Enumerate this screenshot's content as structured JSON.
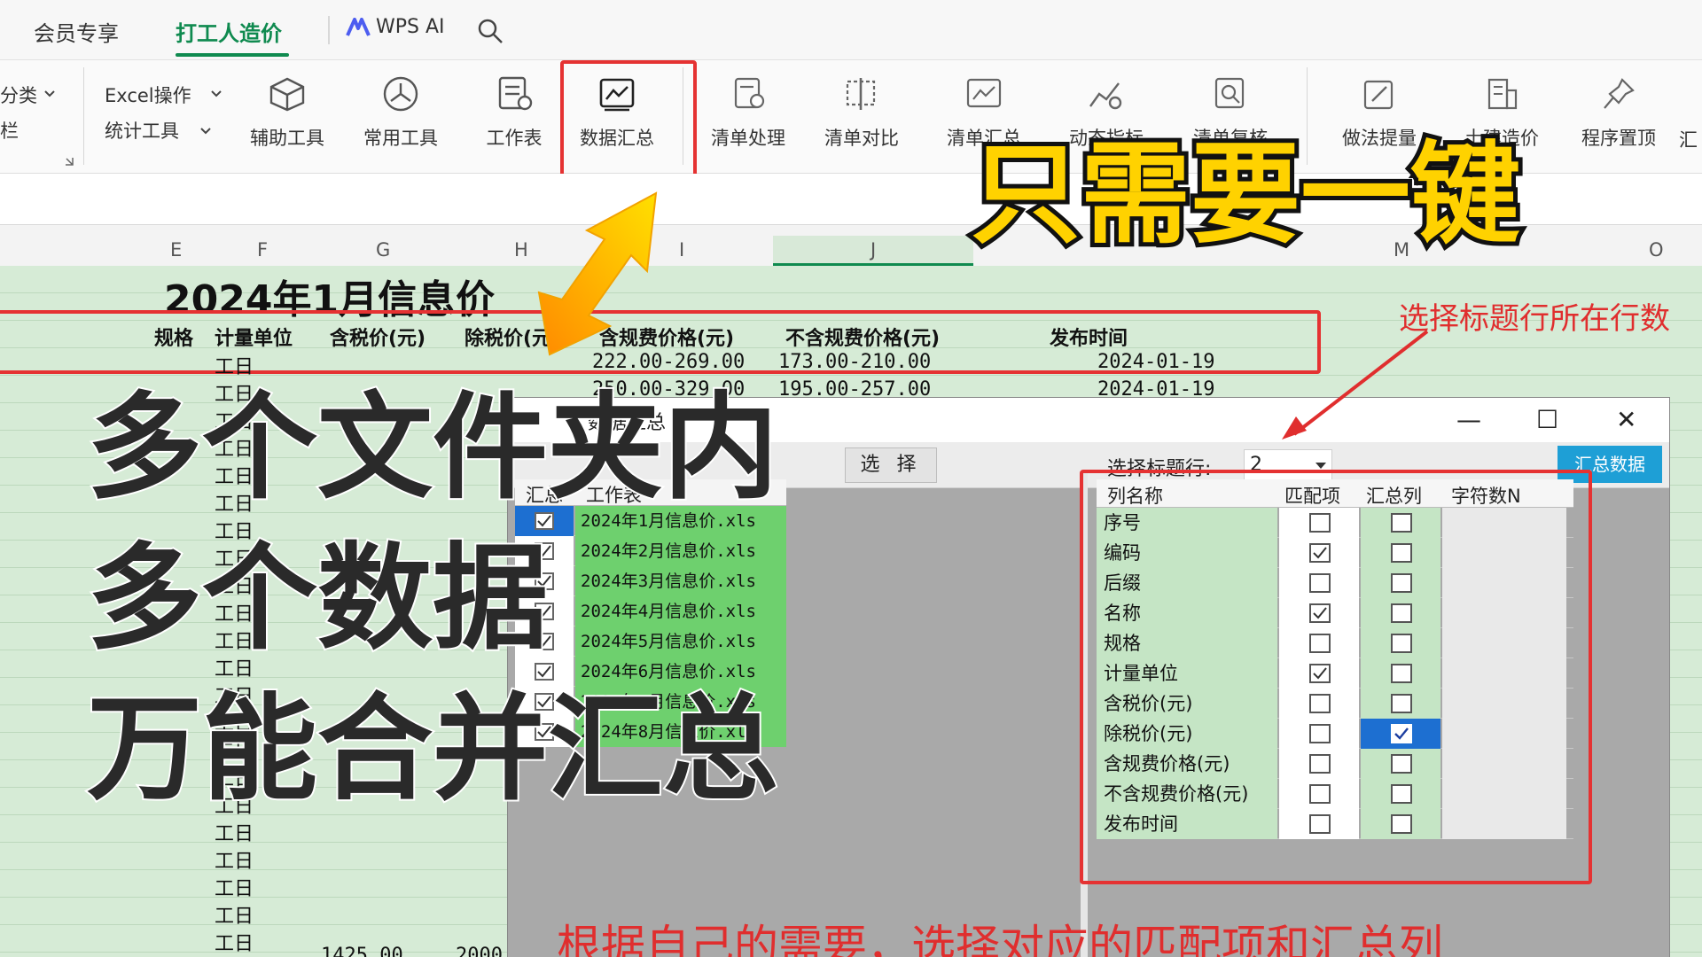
{
  "top_tabs": {
    "member": "会员专享",
    "active": "打工人造价",
    "wps_ai": "WPS AI"
  },
  "ribbon": {
    "left_labels": [
      "分类",
      "栏"
    ],
    "excel_ops": "Excel操作",
    "stats_tools": "统计工具",
    "items": [
      "辅助工具",
      "常用工具",
      "工作表",
      "数据汇总",
      "清单处理",
      "清单对比",
      "清单汇总",
      "动态指标",
      "清单复核",
      "做法提量",
      "土建造价",
      "程序置顶",
      "汇"
    ],
    "highlighted": "数据汇总"
  },
  "column_headers": [
    "E",
    "F",
    "G",
    "H",
    "I",
    "J",
    "M",
    "O"
  ],
  "sheet": {
    "title": "2024年1月信息价",
    "headers": [
      "规格",
      "计量单位",
      "含税价(元)",
      "除税价(元)",
      "含规费价格(元)",
      "不含规费价格(元)",
      "发布时间"
    ],
    "rows": [
      {
        "unit": "工日",
        "incl": "222.00-269.00",
        "excl": "173.00-210.00",
        "date": "2024-01-19"
      },
      {
        "unit": "工日",
        "incl": "250.00-329.00",
        "excl": "195.00-257.00",
        "date": "2024-01-19"
      }
    ],
    "unit_repeat": "工日",
    "bottom_values": [
      "1425.00",
      "2000"
    ]
  },
  "dialog": {
    "title": "数据汇总",
    "select_button": "选 择",
    "header_row_label": "选择标题行:",
    "header_row_value": "2",
    "summarize_button": "汇总数据",
    "file_table": {
      "headers": [
        "汇总",
        "工作表"
      ],
      "files": [
        {
          "name": "2024年1月信息价.xls",
          "checked": true,
          "selected": true
        },
        {
          "name": "2024年2月信息价.xls",
          "checked": true,
          "selected": false
        },
        {
          "name": "2024年3月信息价.xls",
          "checked": true,
          "selected": false
        },
        {
          "name": "2024年4月信息价.xls",
          "checked": true,
          "selected": false
        },
        {
          "name": "2024年5月信息价.xls",
          "checked": true,
          "selected": false
        },
        {
          "name": "2024年6月信息价.xls",
          "checked": true,
          "selected": false
        },
        {
          "name": "2024年7月信息价.xls",
          "checked": true,
          "selected": false
        },
        {
          "name": "2024年8月信息价.xls",
          "checked": true,
          "selected": false
        }
      ]
    },
    "column_table": {
      "headers": [
        "列名称",
        "匹配项",
        "汇总列",
        "字符数N"
      ],
      "rows": [
        {
          "name": "序号",
          "match": false,
          "sum": false
        },
        {
          "name": "编码",
          "match": true,
          "sum": false
        },
        {
          "name": "后缀",
          "match": false,
          "sum": false
        },
        {
          "name": "名称",
          "match": true,
          "sum": false
        },
        {
          "name": "规格",
          "match": false,
          "sum": false
        },
        {
          "name": "计量单位",
          "match": true,
          "sum": false
        },
        {
          "name": "含税价(元)",
          "match": false,
          "sum": false
        },
        {
          "name": "除税价(元)",
          "match": false,
          "sum": true,
          "selected": true
        },
        {
          "name": "含规费价格(元)",
          "match": false,
          "sum": false
        },
        {
          "name": "不含规费价格(元)",
          "match": false,
          "sum": false
        },
        {
          "name": "发布时间",
          "match": false,
          "sum": false
        }
      ]
    }
  },
  "overlay": {
    "headline": "只需要一键",
    "caption_lines": [
      "多个文件夹内",
      "多个数据",
      "万能合并汇总"
    ],
    "note_top": "选择标题行所在行数",
    "note_bottom": "根据自己的需要，选择对应的匹配项和汇总列"
  },
  "colors": {
    "accent_green": "#0f8a4f",
    "highlight_red": "#e53232",
    "headline_yellow": "#ffd200",
    "sheet_green": "#d6ebd6",
    "button_blue": "#1e9fd6"
  }
}
